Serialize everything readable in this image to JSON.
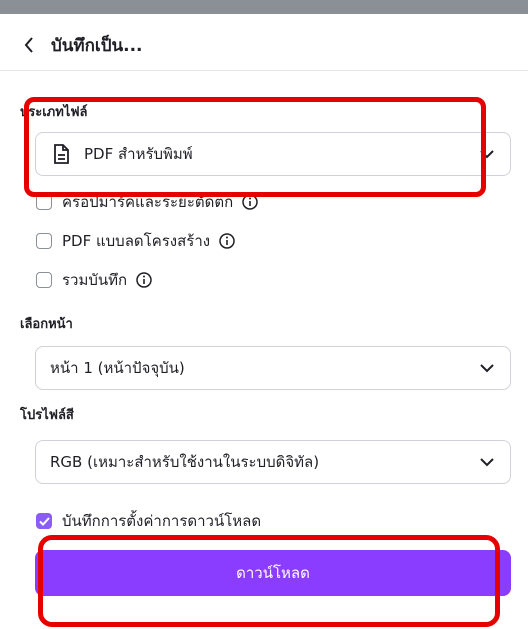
{
  "header": {
    "title": "บันทึกเป็น..."
  },
  "file_type": {
    "label": "ประเภทไฟล์",
    "selected": "PDF สำหรับพิมพ์"
  },
  "options": [
    {
      "label": "ครอปมาร์คและระยะตัดตก",
      "checked": false
    },
    {
      "label": "PDF แบบลดโครงสร้าง",
      "checked": false
    },
    {
      "label": "รวมบันทึก",
      "checked": false
    }
  ],
  "pages": {
    "label": "เลือกหน้า",
    "selected": "หน้า 1 (หน้าปัจจุบัน)"
  },
  "color_profile": {
    "label": "โปรไฟล์สี",
    "selected": "RGB (เหมาะสำหรับใช้งานในระบบดิจิทัล)"
  },
  "save_settings": {
    "label": "บันทึกการตั้งค่าการดาวน์โหลด",
    "checked": true
  },
  "download_button": {
    "label": "ดาวน์โหลด"
  },
  "colors": {
    "accent": "#8b3dff",
    "annotation": "#e60000"
  }
}
